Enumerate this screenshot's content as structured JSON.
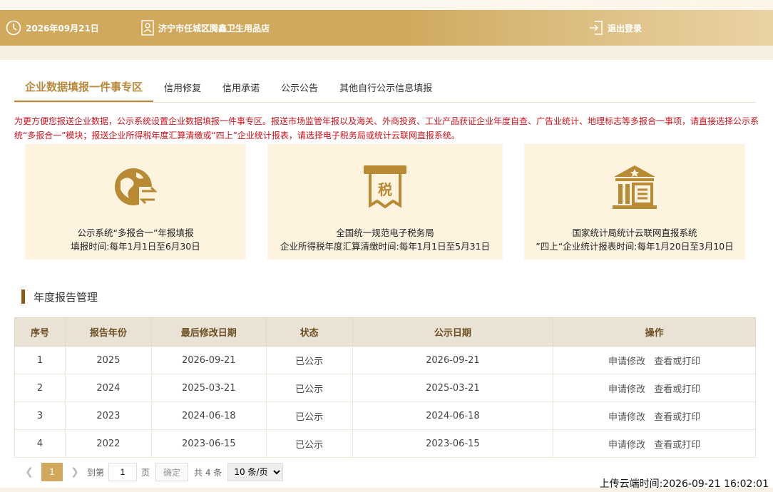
{
  "header": {
    "date": "2026年09月21日",
    "store_name": "济宁市任城区腾鑫卫生用品店",
    "logout": "退出登录"
  },
  "tabs": [
    {
      "label": "企业数据填报一件事专区",
      "active": true
    },
    {
      "label": "信用修复"
    },
    {
      "label": "信用承诺"
    },
    {
      "label": "公示公告"
    },
    {
      "label": "其他自行公示信息填报"
    }
  ],
  "notice": "为更方便您报送企业数据，公示系统设置企业数据填报一件事专区。报送市场监管年报以及海关、外商投资、工业产品获证企业年度自查、广告业统计、地理标志等多报合一事项，请直接选择公示系统“多报合一”模块；报送企业所得税年度汇算清缴或“四上”企业统计报表，请选择电子税务局或统计云联网直报系统。",
  "cards": [
    {
      "icon": "globe-exchange-icon",
      "line1": "公示系统“多报合一”年报填报",
      "line2": "填报时间:每年1月1日至6月30日"
    },
    {
      "icon": "tax-document-icon",
      "tax_char": "税",
      "line1": "全国统一规范电子税务局",
      "line2": "企业所得税年度汇算清缴时间:每年1月1日至5月31日"
    },
    {
      "icon": "government-building-icon",
      "line1": "国家统计局统计云联网直报系统",
      "line2": "”四上“企业统计报表时间:每年1月20日至3月10日"
    }
  ],
  "section_title": "年度报告管理",
  "table": {
    "headers": [
      "序号",
      "报告年份",
      "最后修改日期",
      "状态",
      "公示日期",
      "操作"
    ],
    "rows": [
      {
        "no": "1",
        "year": "2025",
        "modified": "2026-09-21",
        "status": "已公示",
        "publish": "2026-09-21",
        "op1": "申请修改",
        "op2": "查看或打印"
      },
      {
        "no": "2",
        "year": "2024",
        "modified": "2025-03-21",
        "status": "已公示",
        "publish": "2025-03-21",
        "op1": "申请修改",
        "op2": "查看或打印"
      },
      {
        "no": "3",
        "year": "2023",
        "modified": "2024-06-18",
        "status": "已公示",
        "publish": "2024-06-18",
        "op1": "申请修改",
        "op2": "查看或打印"
      },
      {
        "no": "4",
        "year": "2022",
        "modified": "2023-06-15",
        "status": "已公示",
        "publish": "2023-06-15",
        "op1": "申请修改",
        "op2": "查看或打印"
      }
    ]
  },
  "pager": {
    "current_page": "1",
    "goto_label": "到第",
    "goto_value": "1",
    "page_unit": "页",
    "confirm": "确定",
    "total": "共 4 条",
    "page_size": "10 条/页"
  },
  "upload_time": "上传云端时间:2026-09-21 16:02:01",
  "colors": {
    "header_bg": "#d0a95d",
    "accent": "#b8893a",
    "notice_red": "#d0121b",
    "card_bg": "#fdf3df",
    "icon_gold": "#b88a33"
  }
}
